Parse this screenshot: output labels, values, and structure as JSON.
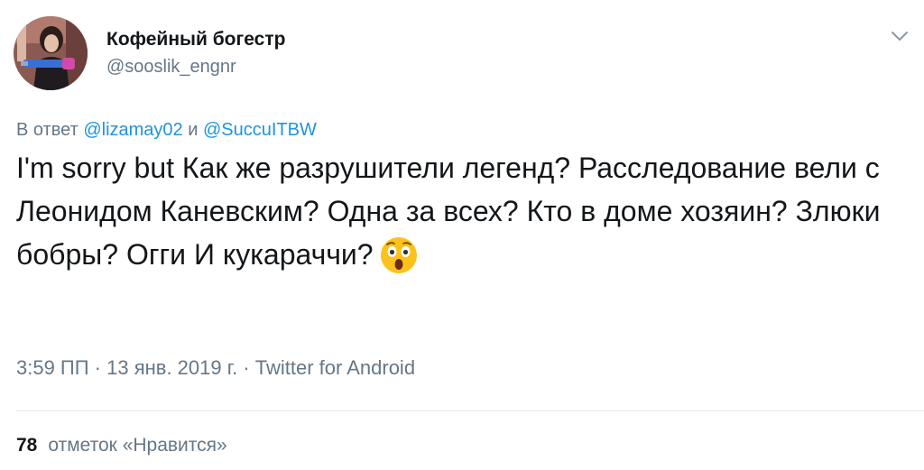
{
  "user": {
    "display_name": "Кофейный богестр",
    "handle": "@sooslik_engnr",
    "avatar_icon": "user-avatar-photo"
  },
  "reply": {
    "prefix": "В ответ",
    "mention_1": "@lizamay02",
    "conjunction": "и",
    "mention_2": "@SuccuITBW"
  },
  "tweet": {
    "text": "I'm sorry but Как же разрушители легенд? Расследование вели с Леонидом Каневским? Одна за всех? Кто в доме хозяин? Злюки бобры? Огги И кукараччи?",
    "emoji_icon": "astonished-face-emoji"
  },
  "meta": {
    "time": "3:59 ПП",
    "separator_1": " · ",
    "date": "13 янв. 2019 г.",
    "separator_2": " · ",
    "source": "Twitter for Android"
  },
  "stats": {
    "likes_count": "78",
    "likes_label": "отметок «Нравится»"
  },
  "colors": {
    "link": "#1b95e0",
    "secondary_text": "#657786",
    "primary_text": "#14171a",
    "divider": "#e1e8ed"
  }
}
